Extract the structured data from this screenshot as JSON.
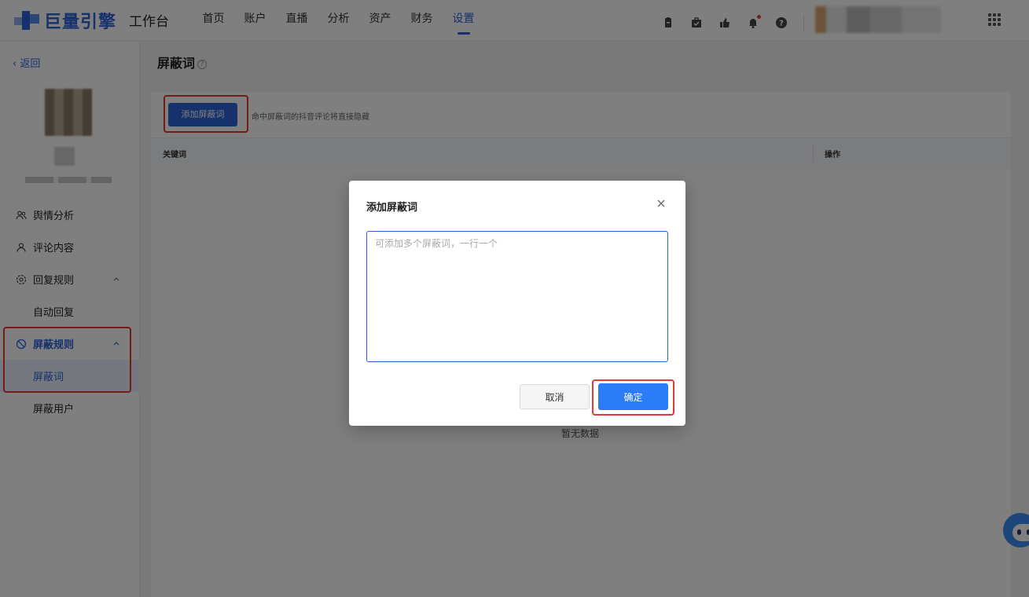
{
  "header": {
    "brand": "巨量引擎",
    "workbench": "工作台",
    "nav": [
      {
        "label": "首页"
      },
      {
        "label": "账户"
      },
      {
        "label": "直播"
      },
      {
        "label": "分析"
      },
      {
        "label": "资产"
      },
      {
        "label": "财务"
      },
      {
        "label": "设置",
        "active": true
      }
    ],
    "icons": [
      "clipboard-icon",
      "briefcase-icon",
      "thumbs-up-icon",
      "bell-icon",
      "help-icon"
    ],
    "accent": "#2d63d8"
  },
  "sidebar": {
    "back_label": "返回",
    "menu": [
      {
        "label": "舆情分析",
        "icon": "people-icon"
      },
      {
        "label": "评论内容",
        "icon": "user-icon"
      },
      {
        "label": "回复规则",
        "icon": "settings-icon",
        "expanded": true
      },
      {
        "label": "自动回复",
        "sub": true
      },
      {
        "label": "屏蔽规则",
        "icon": "block-icon",
        "expanded": true,
        "active": true
      },
      {
        "label": "屏蔽词",
        "sub": true,
        "selected": true
      },
      {
        "label": "屏蔽用户",
        "sub": true
      }
    ]
  },
  "content": {
    "title": "屏蔽词",
    "help_icon": "question-circle-icon",
    "add_button": "添加屏蔽词",
    "add_hint": "命中屏蔽词的抖音评论将直接隐藏",
    "table": {
      "columns": [
        "关键词",
        "操作"
      ],
      "empty_text": "暂无数据"
    }
  },
  "modal": {
    "title": "添加屏蔽词",
    "textarea_value": "",
    "textarea_placeholder": "可添加多个屏蔽词，一行一个",
    "cancel_label": "取消",
    "ok_label": "确定",
    "ok_color": "#2b7cf6",
    "highlight_color": "#e53935"
  }
}
